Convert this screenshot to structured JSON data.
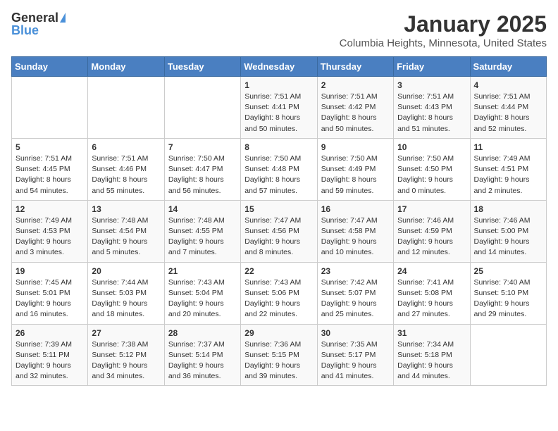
{
  "logo": {
    "general": "General",
    "blue": "Blue"
  },
  "header": {
    "month": "January 2025",
    "location": "Columbia Heights, Minnesota, United States"
  },
  "weekdays": [
    "Sunday",
    "Monday",
    "Tuesday",
    "Wednesday",
    "Thursday",
    "Friday",
    "Saturday"
  ],
  "weeks": [
    [
      {
        "day": "",
        "sunrise": "",
        "sunset": "",
        "daylight": ""
      },
      {
        "day": "",
        "sunrise": "",
        "sunset": "",
        "daylight": ""
      },
      {
        "day": "",
        "sunrise": "",
        "sunset": "",
        "daylight": ""
      },
      {
        "day": "1",
        "sunrise": "Sunrise: 7:51 AM",
        "sunset": "Sunset: 4:41 PM",
        "daylight": "Daylight: 8 hours and 50 minutes."
      },
      {
        "day": "2",
        "sunrise": "Sunrise: 7:51 AM",
        "sunset": "Sunset: 4:42 PM",
        "daylight": "Daylight: 8 hours and 50 minutes."
      },
      {
        "day": "3",
        "sunrise": "Sunrise: 7:51 AM",
        "sunset": "Sunset: 4:43 PM",
        "daylight": "Daylight: 8 hours and 51 minutes."
      },
      {
        "day": "4",
        "sunrise": "Sunrise: 7:51 AM",
        "sunset": "Sunset: 4:44 PM",
        "daylight": "Daylight: 8 hours and 52 minutes."
      }
    ],
    [
      {
        "day": "5",
        "sunrise": "Sunrise: 7:51 AM",
        "sunset": "Sunset: 4:45 PM",
        "daylight": "Daylight: 8 hours and 54 minutes."
      },
      {
        "day": "6",
        "sunrise": "Sunrise: 7:51 AM",
        "sunset": "Sunset: 4:46 PM",
        "daylight": "Daylight: 8 hours and 55 minutes."
      },
      {
        "day": "7",
        "sunrise": "Sunrise: 7:50 AM",
        "sunset": "Sunset: 4:47 PM",
        "daylight": "Daylight: 8 hours and 56 minutes."
      },
      {
        "day": "8",
        "sunrise": "Sunrise: 7:50 AM",
        "sunset": "Sunset: 4:48 PM",
        "daylight": "Daylight: 8 hours and 57 minutes."
      },
      {
        "day": "9",
        "sunrise": "Sunrise: 7:50 AM",
        "sunset": "Sunset: 4:49 PM",
        "daylight": "Daylight: 8 hours and 59 minutes."
      },
      {
        "day": "10",
        "sunrise": "Sunrise: 7:50 AM",
        "sunset": "Sunset: 4:50 PM",
        "daylight": "Daylight: 9 hours and 0 minutes."
      },
      {
        "day": "11",
        "sunrise": "Sunrise: 7:49 AM",
        "sunset": "Sunset: 4:51 PM",
        "daylight": "Daylight: 9 hours and 2 minutes."
      }
    ],
    [
      {
        "day": "12",
        "sunrise": "Sunrise: 7:49 AM",
        "sunset": "Sunset: 4:53 PM",
        "daylight": "Daylight: 9 hours and 3 minutes."
      },
      {
        "day": "13",
        "sunrise": "Sunrise: 7:48 AM",
        "sunset": "Sunset: 4:54 PM",
        "daylight": "Daylight: 9 hours and 5 minutes."
      },
      {
        "day": "14",
        "sunrise": "Sunrise: 7:48 AM",
        "sunset": "Sunset: 4:55 PM",
        "daylight": "Daylight: 9 hours and 7 minutes."
      },
      {
        "day": "15",
        "sunrise": "Sunrise: 7:47 AM",
        "sunset": "Sunset: 4:56 PM",
        "daylight": "Daylight: 9 hours and 8 minutes."
      },
      {
        "day": "16",
        "sunrise": "Sunrise: 7:47 AM",
        "sunset": "Sunset: 4:58 PM",
        "daylight": "Daylight: 9 hours and 10 minutes."
      },
      {
        "day": "17",
        "sunrise": "Sunrise: 7:46 AM",
        "sunset": "Sunset: 4:59 PM",
        "daylight": "Daylight: 9 hours and 12 minutes."
      },
      {
        "day": "18",
        "sunrise": "Sunrise: 7:46 AM",
        "sunset": "Sunset: 5:00 PM",
        "daylight": "Daylight: 9 hours and 14 minutes."
      }
    ],
    [
      {
        "day": "19",
        "sunrise": "Sunrise: 7:45 AM",
        "sunset": "Sunset: 5:01 PM",
        "daylight": "Daylight: 9 hours and 16 minutes."
      },
      {
        "day": "20",
        "sunrise": "Sunrise: 7:44 AM",
        "sunset": "Sunset: 5:03 PM",
        "daylight": "Daylight: 9 hours and 18 minutes."
      },
      {
        "day": "21",
        "sunrise": "Sunrise: 7:43 AM",
        "sunset": "Sunset: 5:04 PM",
        "daylight": "Daylight: 9 hours and 20 minutes."
      },
      {
        "day": "22",
        "sunrise": "Sunrise: 7:43 AM",
        "sunset": "Sunset: 5:06 PM",
        "daylight": "Daylight: 9 hours and 22 minutes."
      },
      {
        "day": "23",
        "sunrise": "Sunrise: 7:42 AM",
        "sunset": "Sunset: 5:07 PM",
        "daylight": "Daylight: 9 hours and 25 minutes."
      },
      {
        "day": "24",
        "sunrise": "Sunrise: 7:41 AM",
        "sunset": "Sunset: 5:08 PM",
        "daylight": "Daylight: 9 hours and 27 minutes."
      },
      {
        "day": "25",
        "sunrise": "Sunrise: 7:40 AM",
        "sunset": "Sunset: 5:10 PM",
        "daylight": "Daylight: 9 hours and 29 minutes."
      }
    ],
    [
      {
        "day": "26",
        "sunrise": "Sunrise: 7:39 AM",
        "sunset": "Sunset: 5:11 PM",
        "daylight": "Daylight: 9 hours and 32 minutes."
      },
      {
        "day": "27",
        "sunrise": "Sunrise: 7:38 AM",
        "sunset": "Sunset: 5:12 PM",
        "daylight": "Daylight: 9 hours and 34 minutes."
      },
      {
        "day": "28",
        "sunrise": "Sunrise: 7:37 AM",
        "sunset": "Sunset: 5:14 PM",
        "daylight": "Daylight: 9 hours and 36 minutes."
      },
      {
        "day": "29",
        "sunrise": "Sunrise: 7:36 AM",
        "sunset": "Sunset: 5:15 PM",
        "daylight": "Daylight: 9 hours and 39 minutes."
      },
      {
        "day": "30",
        "sunrise": "Sunrise: 7:35 AM",
        "sunset": "Sunset: 5:17 PM",
        "daylight": "Daylight: 9 hours and 41 minutes."
      },
      {
        "day": "31",
        "sunrise": "Sunrise: 7:34 AM",
        "sunset": "Sunset: 5:18 PM",
        "daylight": "Daylight: 9 hours and 44 minutes."
      },
      {
        "day": "",
        "sunrise": "",
        "sunset": "",
        "daylight": ""
      }
    ]
  ]
}
